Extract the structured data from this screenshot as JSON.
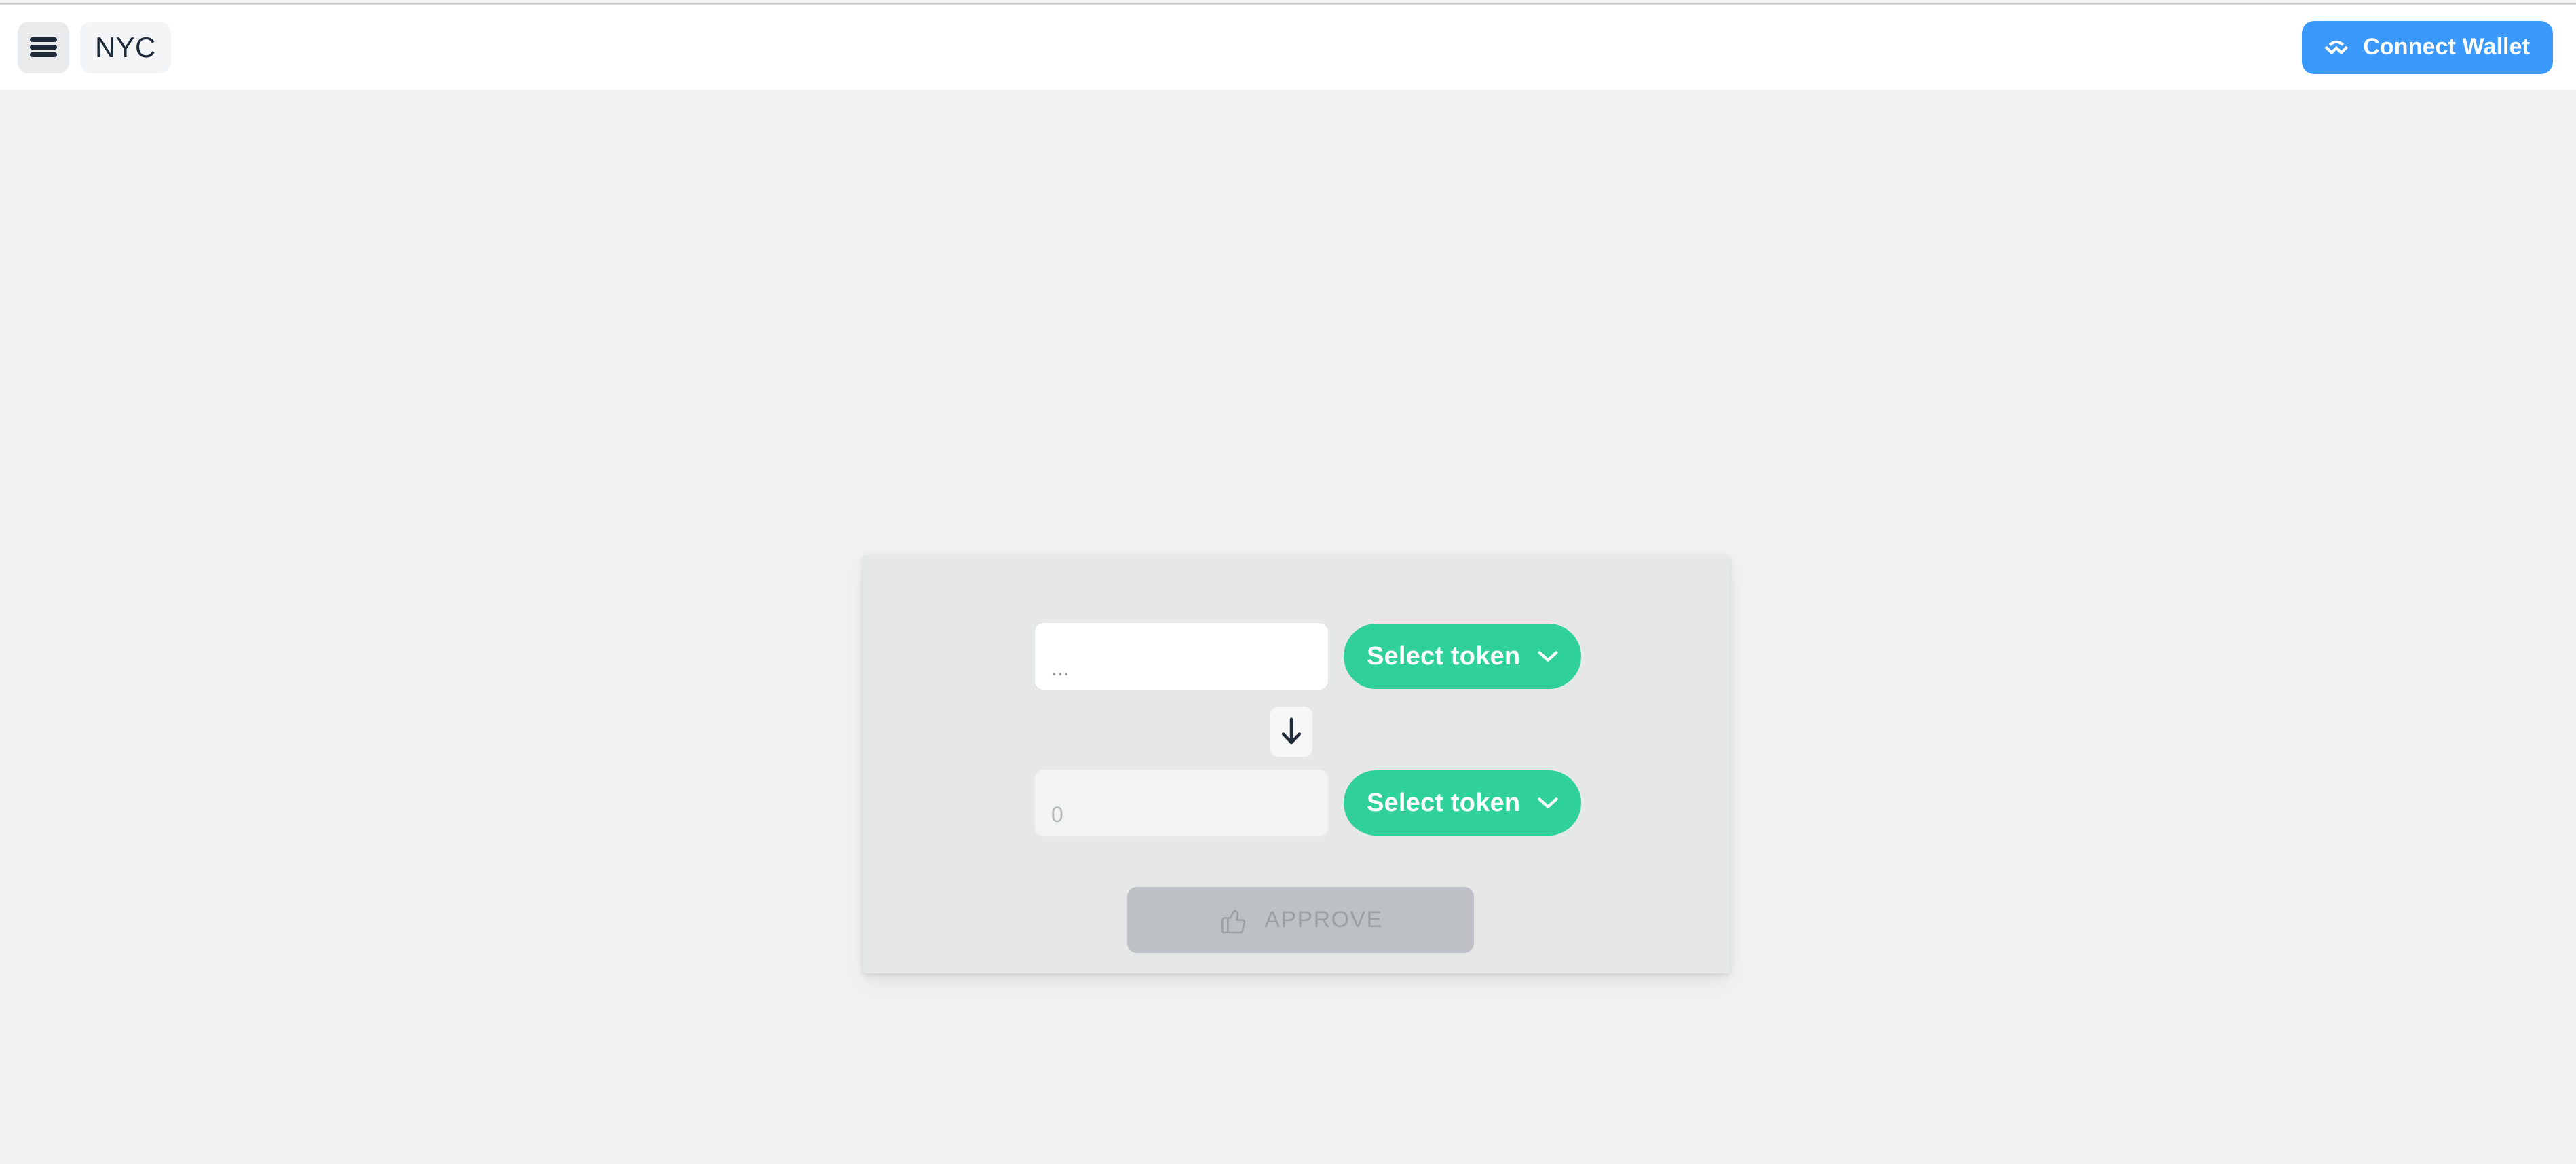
{
  "window": {
    "background_color": "#f2f2f2",
    "header_background": "#ffffff"
  },
  "header": {
    "menu_button": {
      "icon": "hamburger-icon",
      "label": ""
    },
    "brand": {
      "label": "NYC"
    },
    "connect_wallet": {
      "label": "Connect Wallet",
      "icon": "walletconnect-icon",
      "color": "#3b99fc",
      "text_color": "#ffffff"
    }
  },
  "swap_card": {
    "background_color": "#e5e8e7",
    "accent_color": "#2fd09a",
    "input_row": {
      "amount": {
        "value": "",
        "placeholder": "...",
        "disabled": false
      },
      "token_selector": {
        "label": "Select token",
        "icon": "chevron-down-icon",
        "selected": null
      }
    },
    "swap_direction_button": {
      "icon": "arrow-down-icon"
    },
    "output_row": {
      "amount": {
        "value": "",
        "placeholder": "0",
        "disabled": true
      },
      "token_selector": {
        "label": "Select token",
        "icon": "chevron-down-icon",
        "selected": null
      }
    },
    "action_button": {
      "label": "APPROVE",
      "icon": "thumbs-up-icon",
      "disabled": true,
      "background_color": "#bdc0c4",
      "text_color": "#9ba0a6"
    }
  }
}
